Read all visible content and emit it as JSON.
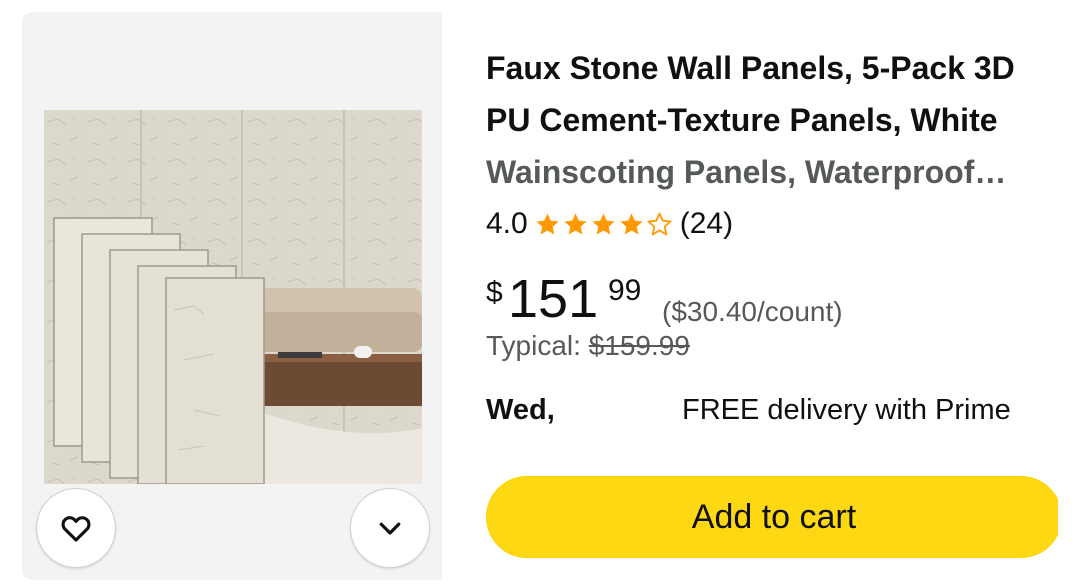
{
  "product": {
    "title_line1": "Faux Stone Wall Panels, 5-Pack 3D",
    "title_line2": "PU Cement-Texture Panels, White",
    "title_line3": "Wainscoting Panels, Waterproof…",
    "rating_value": "4.0",
    "rating_stars": 4,
    "rating_count": "(24)",
    "price_currency": "$",
    "price_whole": "151",
    "price_fraction": "99",
    "unit_price": "($30.40/count)",
    "typical_label": "Typical:",
    "typical_price": "$159.99",
    "delivery_day": "Wed,",
    "delivery_text": "FREE delivery with Prime",
    "add_to_cart_label": "Add to cart"
  },
  "colors": {
    "star": "#ff9900",
    "cart_button": "#ffd814",
    "text": "#0f1111",
    "secondary_text": "#565959"
  },
  "icons": {
    "favorite": "heart-icon",
    "more": "chevron-down-icon"
  }
}
